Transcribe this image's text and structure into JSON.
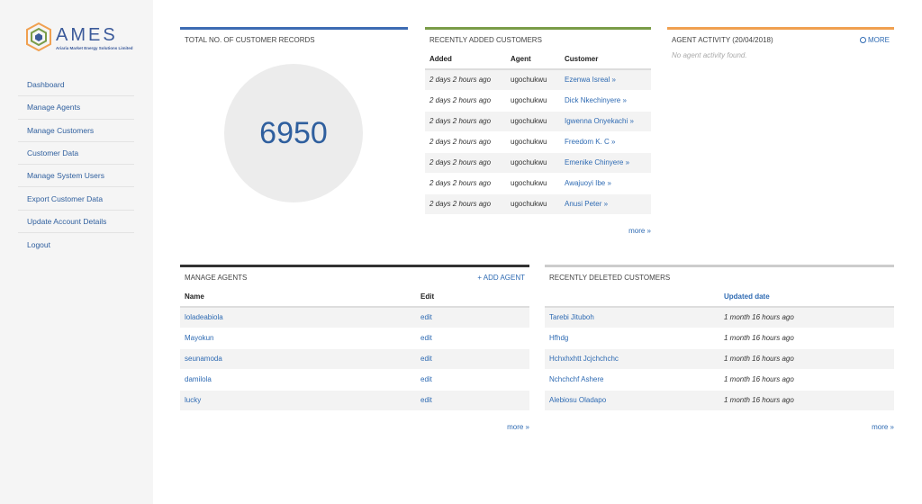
{
  "brand": {
    "name": "AMES",
    "subtitle": "Ariaria Market Energy Solutions Limited"
  },
  "sidebar": {
    "items": [
      {
        "label": "Dashboard"
      },
      {
        "label": "Manage Agents"
      },
      {
        "label": "Manage Customers"
      },
      {
        "label": "Customer Data"
      },
      {
        "label": "Manage System Users"
      },
      {
        "label": "Export Customer Data"
      },
      {
        "label": "Update Account Details"
      },
      {
        "label": "Logout"
      }
    ]
  },
  "total": {
    "title": "TOTAL NO. OF CUSTOMER RECORDS",
    "value": "6950",
    "bar_color": "#3d6cb3"
  },
  "recent_added": {
    "title": "RECENTLY ADDED CUSTOMERS",
    "bar_color": "#7a9c48",
    "headers": {
      "added": "Added",
      "agent": "Agent",
      "customer": "Customer"
    },
    "rows": [
      {
        "added": "2 days 2 hours ago",
        "agent": "ugochukwu",
        "customer": "Ezenwa Isreal »"
      },
      {
        "added": "2 days 2 hours ago",
        "agent": "ugochukwu",
        "customer": "Dick Nkechinyere »"
      },
      {
        "added": "2 days 2 hours ago",
        "agent": "ugochukwu",
        "customer": "Igwenna Onyekachi »"
      },
      {
        "added": "2 days 2 hours ago",
        "agent": "ugochukwu",
        "customer": "Freedom K. C »"
      },
      {
        "added": "2 days 2 hours ago",
        "agent": "ugochukwu",
        "customer": "Emenike Chinyere »"
      },
      {
        "added": "2 days 2 hours ago",
        "agent": "ugochukwu",
        "customer": "Awajuoyi Ibe »"
      },
      {
        "added": "2 days 2 hours ago",
        "agent": "ugochukwu",
        "customer": "Anusi Peter »"
      }
    ],
    "more": "more »"
  },
  "agent_activity": {
    "title": "AGENT ACTIVITY (20/04/2018)",
    "bar_color": "#f0a050",
    "more": "MORE",
    "empty": "No agent activity found."
  },
  "manage_agents": {
    "title": "MANAGE AGENTS",
    "bar_color": "#333333",
    "add": "+ ADD AGENT",
    "headers": {
      "name": "Name",
      "edit": "Edit"
    },
    "rows": [
      {
        "name": "loladeabiola",
        "edit": "edit"
      },
      {
        "name": "Mayokun",
        "edit": "edit"
      },
      {
        "name": "seunamoda",
        "edit": "edit"
      },
      {
        "name": "damilola",
        "edit": "edit"
      },
      {
        "name": "lucky",
        "edit": "edit"
      }
    ],
    "more": "more »"
  },
  "recent_deleted": {
    "title": "RECENTLY DELETED CUSTOMERS",
    "bar_color": "#cccccc",
    "headers": {
      "name": "",
      "updated": "Updated date"
    },
    "rows": [
      {
        "name": "Tarebi Jituboh",
        "updated": "1 month 16 hours ago"
      },
      {
        "name": "Hfhdg",
        "updated": "1 month 16 hours ago"
      },
      {
        "name": "Hchxhxhtt Jcjchchchc",
        "updated": "1 month 16 hours ago"
      },
      {
        "name": "Nchchchf Ashere",
        "updated": "1 month 16 hours ago"
      },
      {
        "name": "Alebiosu Oladapo",
        "updated": "1 month 16 hours ago"
      }
    ],
    "more": "more »"
  }
}
